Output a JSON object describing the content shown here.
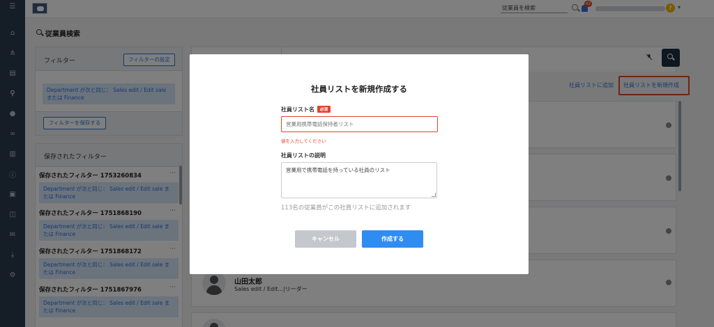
{
  "rail": {
    "icons": [
      "menu-icon",
      "home-icon",
      "org-chart-icon",
      "document-icon",
      "search-icon",
      "chat-icon",
      "link-icon",
      "chart-icon",
      "info-icon",
      "contact-card-icon",
      "book-icon",
      "mail-icon",
      "download-icon",
      "user-settings-icon"
    ]
  },
  "topbar": {
    "search_placeholder": "従業員を検索",
    "notification_count": "42"
  },
  "page": {
    "title": "従業員検索"
  },
  "filter": {
    "header": "フィルター",
    "settings_button": "フィルターの設定",
    "active_chip": "Department が次と同じ： Sales edit / Edit sale または Finance",
    "save_button": "フィルターを保存する"
  },
  "saved_filters": {
    "header": "保存されたフィルター",
    "items": [
      {
        "title": "保存されたフィルター 1753260834",
        "chip": "Department が次と同じ： Sales edit / Edit sale または Finance"
      },
      {
        "title": "保存されたフィルター 1751868190",
        "chip": "Department が次と同じ： Sales edit / Edit sale または Finance"
      },
      {
        "title": "保存されたフィルター 1751868172",
        "chip": "Department が次と同じ： Sales edit / Edit sale または Finance"
      },
      {
        "title": "保存されたフィルター 1751867976",
        "chip": "Department が次と同じ： Sales edit / Edit sale または Finance"
      }
    ]
  },
  "results": {
    "add_to_list_link": "社員リストに追加",
    "create_list_link": "社員リストを新規作成",
    "visible_employee": {
      "name": "山田太郎",
      "role": "Sales edit / Edit...|リーダー"
    }
  },
  "modal": {
    "title": "社員リストを新規作成する",
    "name_label": "社員リスト名",
    "required_badge": "必須",
    "name_placeholder": "営業用携帯電話保持者リスト",
    "name_error": "値を入力してください",
    "description_label": "社員リストの説明",
    "description_placeholder": "営業用で携帯電話を持っている社員のリスト",
    "note": "113名の従業員がこの社員リストに追加されます",
    "cancel_button": "キャンセル",
    "create_button": "作成する"
  },
  "colors": {
    "accent": "#2f73da",
    "error": "#e2452c",
    "rail": "#2b3a4d"
  }
}
